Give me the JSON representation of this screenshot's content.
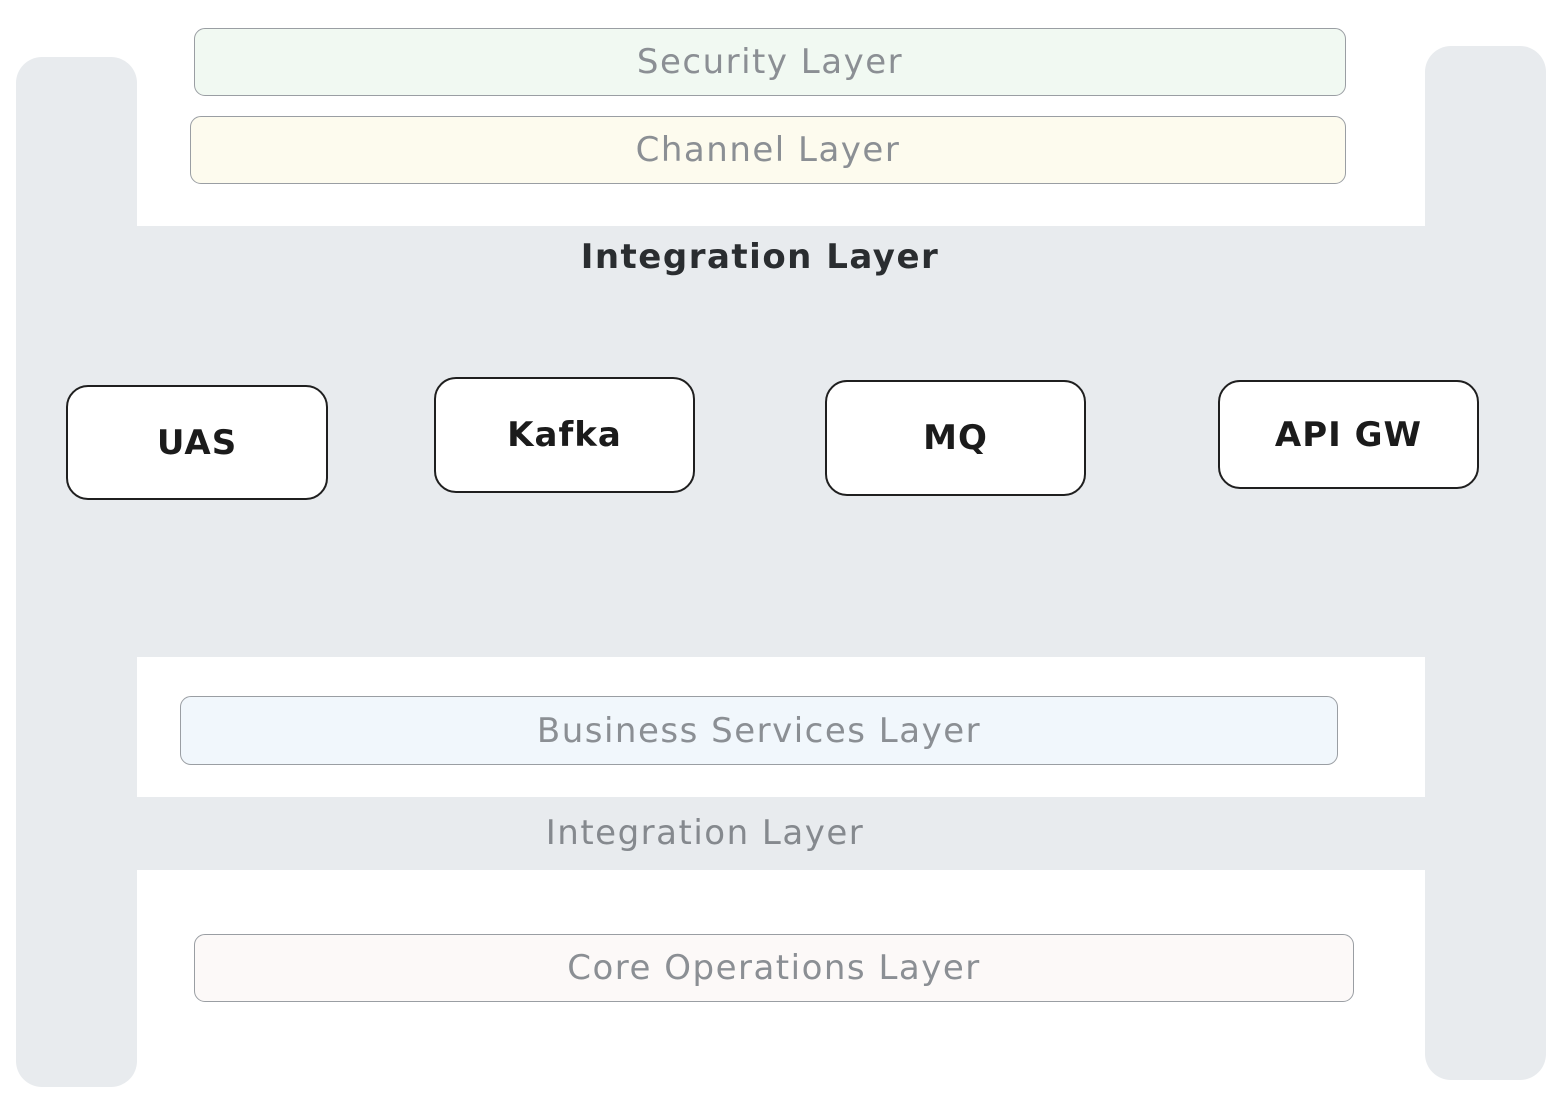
{
  "layers": {
    "security": "Security Layer",
    "channel": "Channel Layer",
    "integration_main": "Integration Layer",
    "business_services": "Business Services Layer",
    "integration_lower": "Integration Layer",
    "core_operations": "Core Operations Layer"
  },
  "components": [
    "UAS",
    "Kafka",
    "MQ",
    "API GW"
  ],
  "colors": {
    "frame_grey": "#e8ebee",
    "security_fill": "#f1f9f2",
    "channel_fill": "#fdfbee",
    "business_fill": "#f1f7fc",
    "core_fill": "#fcf9f8",
    "component_border": "#1f1f1f"
  }
}
